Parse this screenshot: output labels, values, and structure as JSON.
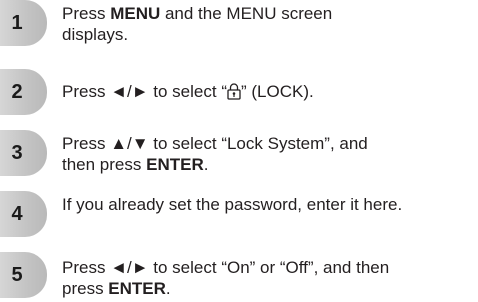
{
  "steps": [
    {
      "number": "1",
      "parts": {
        "a": "Press ",
        "b": "MENU",
        "c": " and the MENU screen",
        "d": "displays."
      }
    },
    {
      "number": "2",
      "parts": {
        "a": "Press ",
        "b": "◄/►",
        "c": " to select “",
        "d": "” (LOCK)."
      },
      "icon": "lock-icon"
    },
    {
      "number": "3",
      "parts": {
        "a": "Press ",
        "b": "▲/▼",
        "c": " to select “Lock System”, and",
        "d": "then press ",
        "e": "ENTER",
        "f": "."
      }
    },
    {
      "number": "4",
      "parts": {
        "a": "If you already set the password, enter it here."
      }
    },
    {
      "number": "5",
      "parts": {
        "a": "Press ",
        "b": "◄/►",
        "c": " to select “On” or “Off”, and then",
        "d": "press ",
        "e": "ENTER",
        "f": "."
      }
    }
  ]
}
